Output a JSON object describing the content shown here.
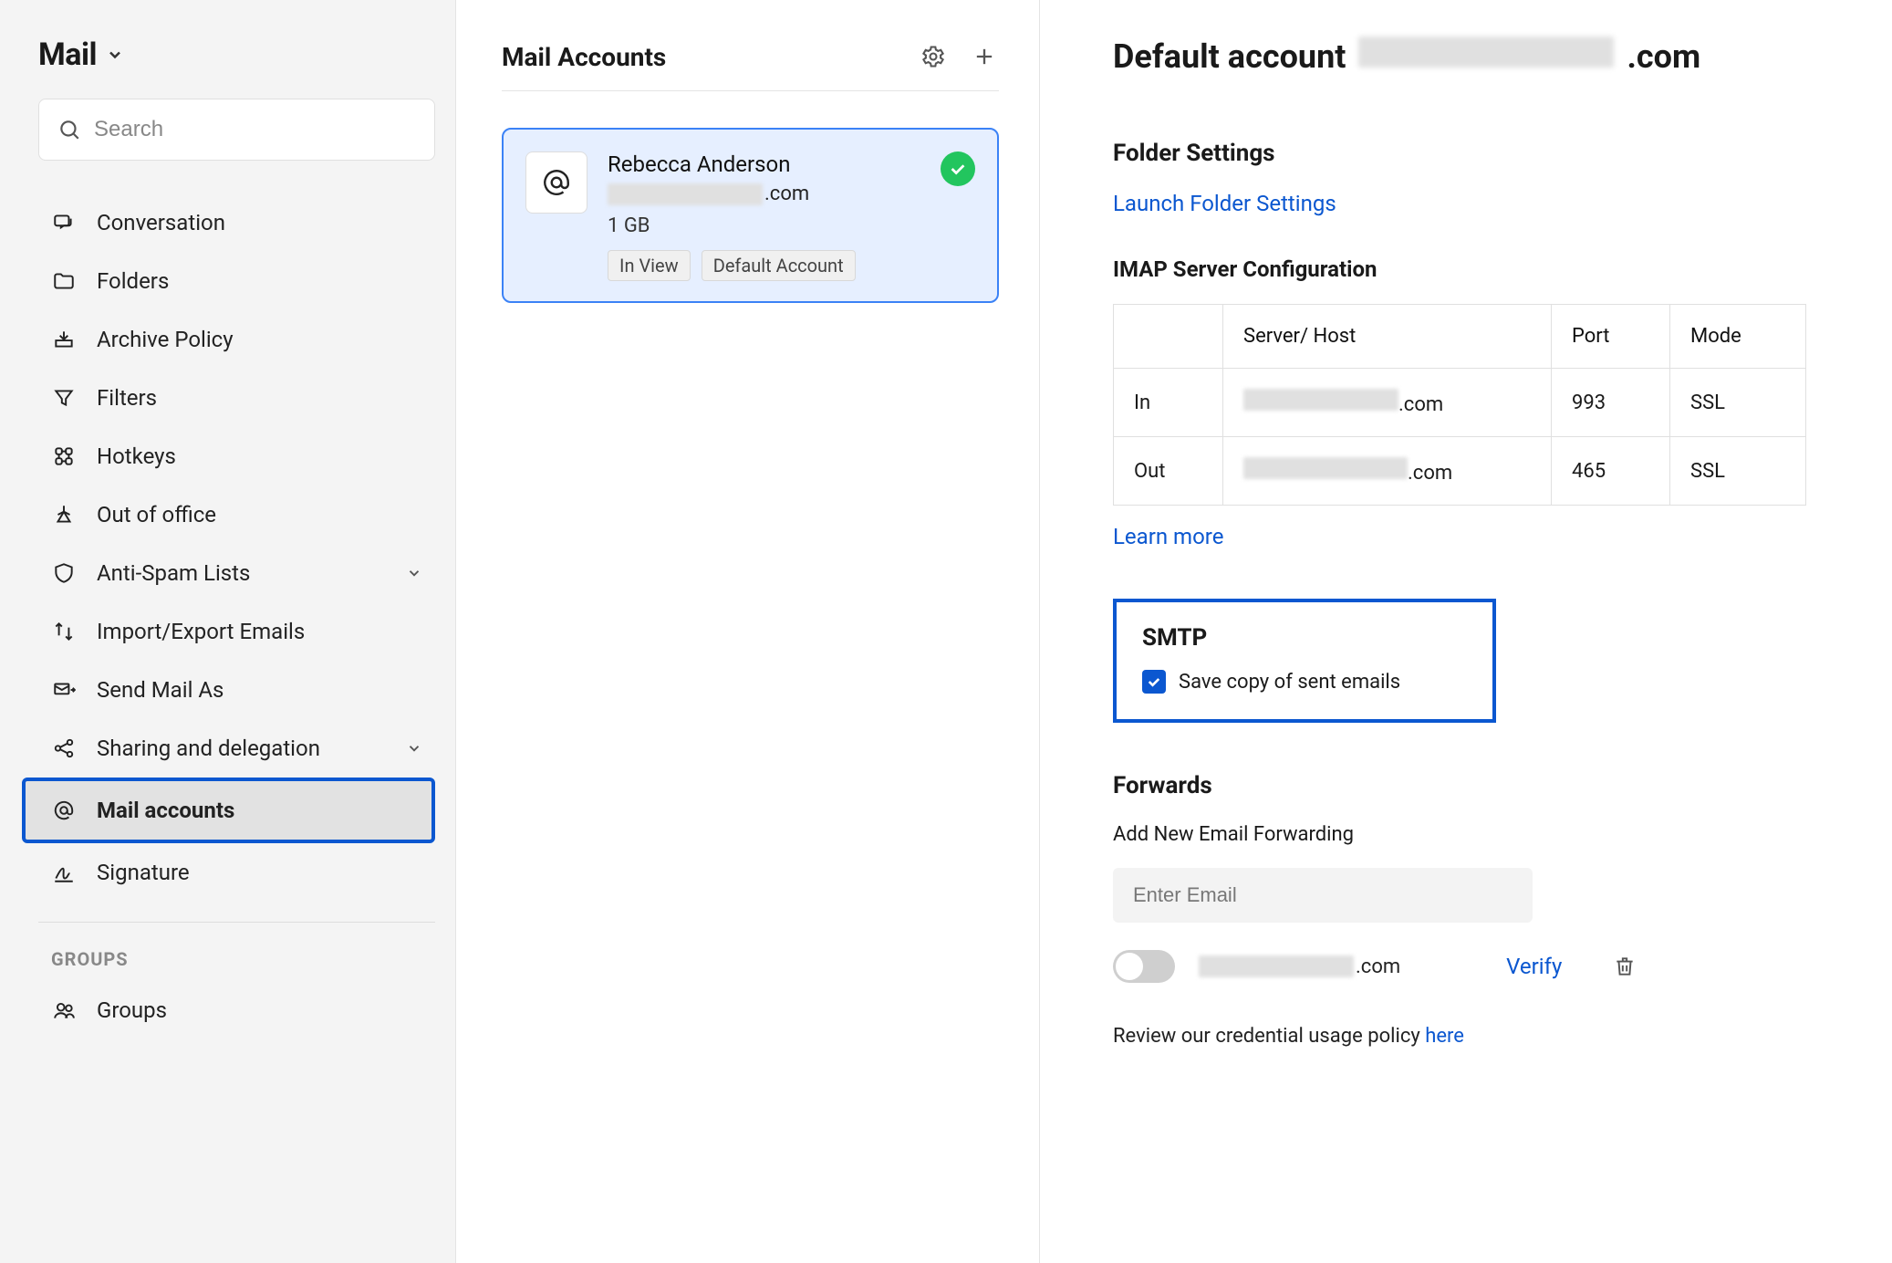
{
  "sidebar": {
    "title": "Mail",
    "search_placeholder": "Search",
    "items": [
      {
        "label": "Conversation"
      },
      {
        "label": "Folders"
      },
      {
        "label": "Archive Policy"
      },
      {
        "label": "Filters"
      },
      {
        "label": "Hotkeys"
      },
      {
        "label": "Out of office"
      },
      {
        "label": "Anti-Spam Lists",
        "expandable": true
      },
      {
        "label": "Import/Export Emails"
      },
      {
        "label": "Send Mail As"
      },
      {
        "label": "Sharing and delegation",
        "expandable": true
      },
      {
        "label": "Mail accounts",
        "active": true
      },
      {
        "label": "Signature"
      }
    ],
    "groups_header": "GROUPS",
    "groups_item": "Groups"
  },
  "middle": {
    "title": "Mail Accounts",
    "account": {
      "name": "Rebecca Anderson",
      "email_suffix": ".com",
      "size": "1 GB",
      "tag1": "In View",
      "tag2": "Default Account"
    }
  },
  "detail": {
    "title_prefix": "Default account",
    "title_suffix": ".com",
    "folder_settings_heading": "Folder Settings",
    "launch_folder_settings": "Launch Folder Settings",
    "imap_heading": "IMAP Server Configuration",
    "imap_table": {
      "headers": {
        "server": "Server/ Host",
        "port": "Port",
        "mode": "Mode"
      },
      "in": {
        "label": "In",
        "host_suffix": ".com",
        "port": "993",
        "mode": "SSL"
      },
      "out": {
        "label": "Out",
        "host_suffix": ".com",
        "port": "465",
        "mode": "SSL"
      }
    },
    "learn_more": "Learn more",
    "smtp_heading": "SMTP",
    "smtp_checkbox_label": "Save copy of sent emails",
    "forwards_heading": "Forwards",
    "add_fwd_heading": "Add New Email Forwarding",
    "fwd_input_placeholder": "Enter Email",
    "fwd_email_suffix": ".com",
    "verify_label": "Verify",
    "policy_text": "Review our credential usage policy ",
    "policy_link": "here"
  }
}
